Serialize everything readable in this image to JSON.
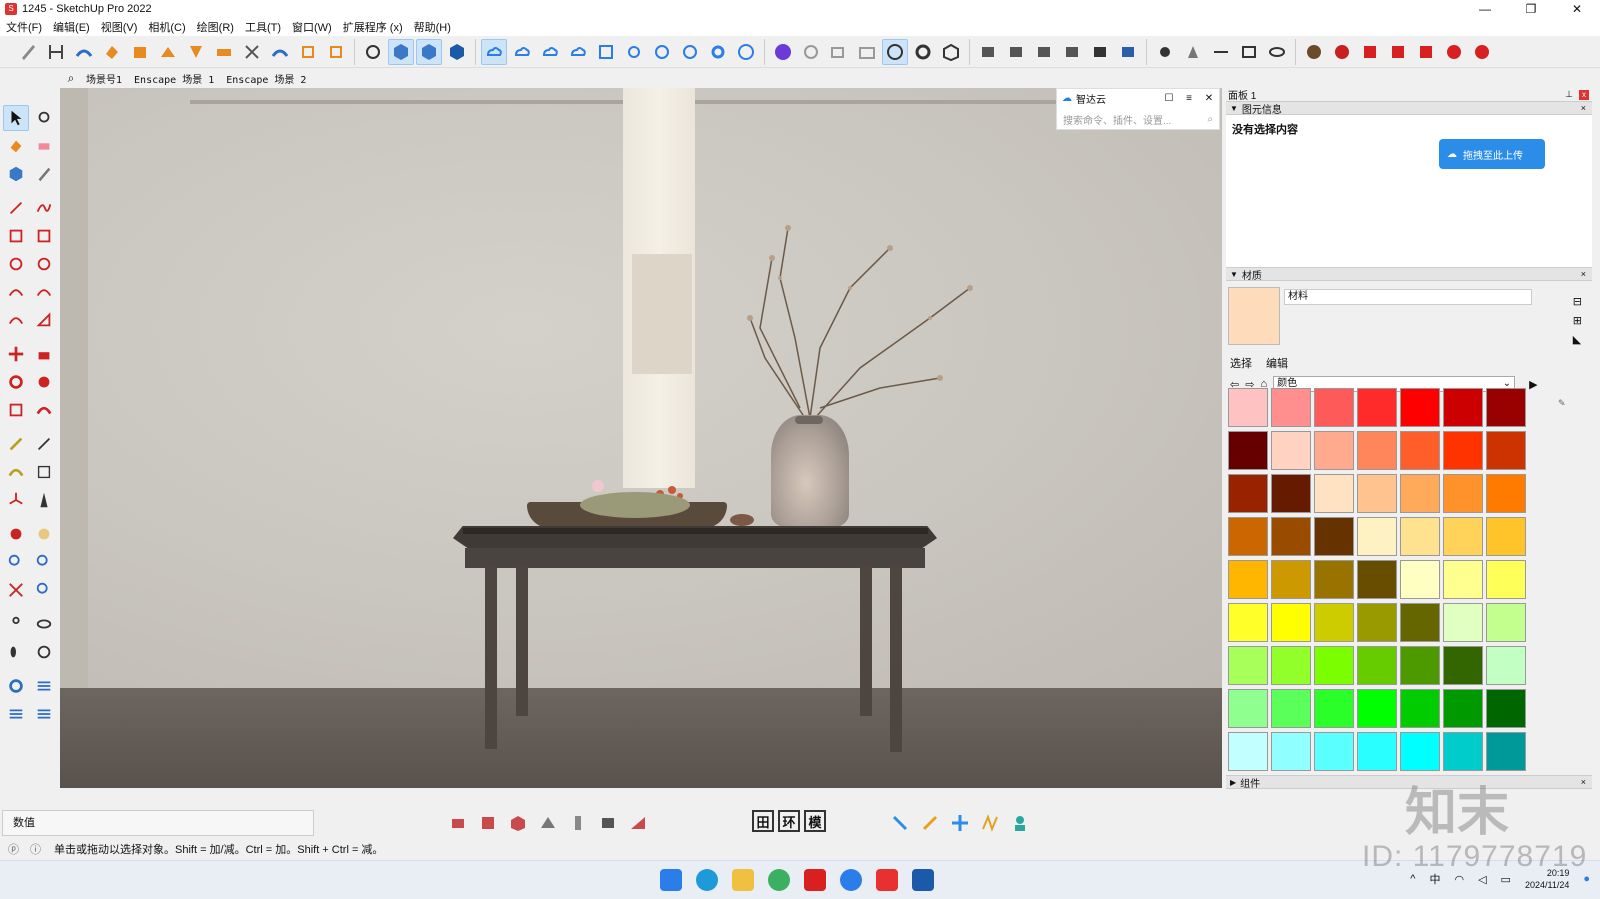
{
  "window": {
    "title": "1245 - SketchUp Pro 2022",
    "controls": [
      "—",
      "❐",
      "✕"
    ]
  },
  "menu": [
    "文件(F)",
    "编辑(E)",
    "视图(V)",
    "相机(C)",
    "绘图(R)",
    "工具(T)",
    "窗口(W)",
    "扩展程序 (x)",
    "帮助(H)"
  ],
  "scenes": {
    "tabs": [
      "场景号1",
      "Enscape 场景 1",
      "Enscape 场景 2"
    ]
  },
  "plugin": {
    "title": "智达云",
    "search_placeholder": "搜索命令、插件、设置..."
  },
  "panel": {
    "title": "面板 1",
    "entity_section": "图元信息",
    "no_selection": "没有选择内容",
    "upload_button": "拖拽至此上传",
    "materials_section": "材质",
    "material_name": "材料",
    "tab_select": "选择",
    "tab_edit": "编辑",
    "collection": "颜色",
    "components_section": "组件",
    "current_material_color": "#fedcbb"
  },
  "palette_colors": [
    "#ffc2c2",
    "#ff8f8f",
    "#ff5a5a",
    "#ff2a2a",
    "#ff0000",
    "#cc0000",
    "#990000",
    "#660000",
    "#ffd2c2",
    "#ffa98f",
    "#ff865a",
    "#ff5e2a",
    "#ff3300",
    "#cc3300",
    "#992200",
    "#661a00",
    "#ffe2c2",
    "#ffc38f",
    "#ffa95a",
    "#ff922a",
    "#ff7b00",
    "#cc6600",
    "#994c00",
    "#663300",
    "#fff2c2",
    "#ffe28f",
    "#ffd35a",
    "#ffc42a",
    "#ffb600",
    "#cc9900",
    "#997300",
    "#664d00",
    "#ffffc2",
    "#ffff8f",
    "#ffff5a",
    "#ffff2a",
    "#ffff00",
    "#cccc00",
    "#999900",
    "#666600",
    "#e2ffc2",
    "#c3ff8f",
    "#a9ff5a",
    "#92ff2a",
    "#7bff00",
    "#66cc00",
    "#4c9900",
    "#336600",
    "#c2ffc2",
    "#8fff8f",
    "#5aff5a",
    "#2aff2a",
    "#00ff00",
    "#00cc00",
    "#009900",
    "#006600",
    "#c2ffff",
    "#8fffff",
    "#5affff",
    "#2affff",
    "#00ffff",
    "#00cccc",
    "#009999"
  ],
  "measurement": {
    "label": "数值"
  },
  "bottom_labels": [
    "田",
    "环",
    "模"
  ],
  "status": {
    "message": "单击或拖动以选择对象。Shift = 加/减。Ctrl = 加。Shift + Ctrl = 减。"
  },
  "taskbar": {
    "time": "20:19",
    "date": "2024/11/24",
    "ime": "中"
  },
  "watermark": {
    "id": "ID: 1179778719",
    "logo": "知末"
  }
}
